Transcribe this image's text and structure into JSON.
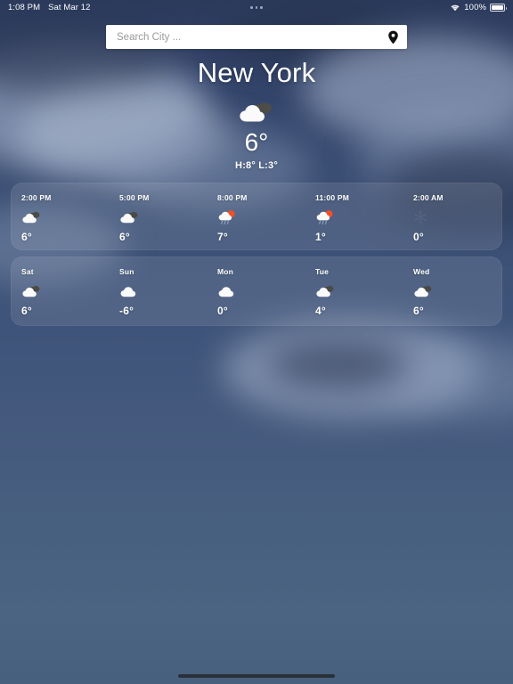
{
  "status_bar": {
    "time": "1:08 PM",
    "date": "Sat Mar 12",
    "multitask_indicator": "three-dots",
    "wifi_icon": "wifi-icon",
    "battery_percent": "100%",
    "battery_icon": "battery-full-icon"
  },
  "search": {
    "placeholder": "Search City ...",
    "value": "",
    "location_icon": "location-pin-icon"
  },
  "current": {
    "city": "New York",
    "icon": "cloud-behind-cloud-icon",
    "temperature": "6°",
    "high_low": "H:8°  L:3°"
  },
  "hourly": [
    {
      "label": "2:00 PM",
      "icon": "cloudy-icon",
      "temp": "6°"
    },
    {
      "label": "5:00 PM",
      "icon": "cloudy-icon",
      "temp": "6°"
    },
    {
      "label": "8:00 PM",
      "icon": "sun-rain-cloud-icon",
      "temp": "7°"
    },
    {
      "label": "11:00 PM",
      "icon": "sun-rain-cloud-icon",
      "temp": "1°"
    },
    {
      "label": "2:00 AM",
      "icon": "snowflake-icon",
      "temp": "0°"
    }
  ],
  "daily": [
    {
      "label": "Sat",
      "icon": "cloudy-icon",
      "temp": "6°"
    },
    {
      "label": "Sun",
      "icon": "cloud-white-icon",
      "temp": "-6°"
    },
    {
      "label": "Mon",
      "icon": "cloud-white-icon",
      "temp": "0°"
    },
    {
      "label": "Tue",
      "icon": "cloudy-icon",
      "temp": "4°"
    },
    {
      "label": "Wed",
      "icon": "cloudy-icon",
      "temp": "6°"
    }
  ],
  "colors": {
    "sky_top": "#2c3a5c",
    "sky_bottom": "#4a6482",
    "card_fill": "rgba(255,255,255,0.10)",
    "text": "#ffffff",
    "search_bg": "#ffffff",
    "home_indicator": "#2b3038"
  },
  "home_indicator": "home-indicator"
}
